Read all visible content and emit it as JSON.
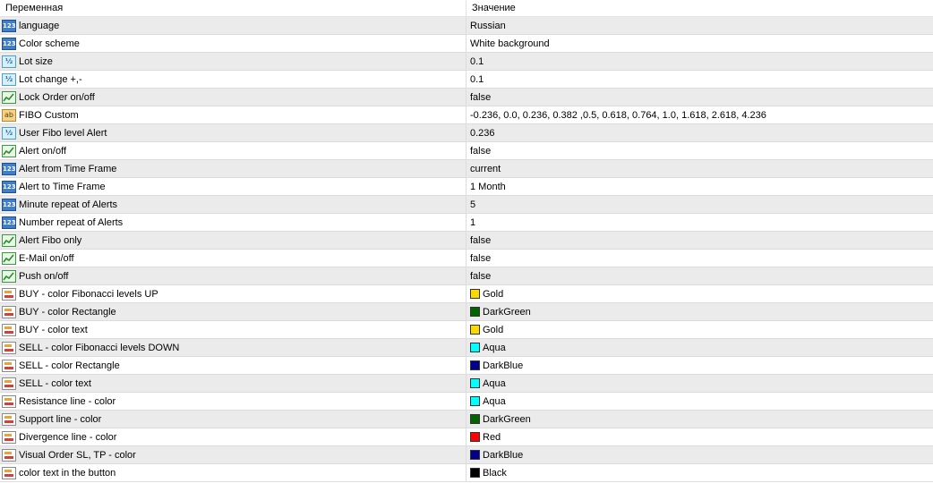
{
  "header": {
    "name_col": "Переменная",
    "value_col": "Значение"
  },
  "rows": [
    {
      "type": "int",
      "icon": "int-123-icon",
      "name": "language",
      "value": "Russian"
    },
    {
      "type": "int",
      "icon": "int-123-icon",
      "name": "Color scheme",
      "value": "White background"
    },
    {
      "type": "double",
      "icon": "double-half-icon",
      "name": "Lot size",
      "value": "0.1"
    },
    {
      "type": "double",
      "icon": "double-half-icon",
      "name": "Lot change +,-",
      "value": "0.1"
    },
    {
      "type": "bool",
      "icon": "bool-chart-icon",
      "name": "Lock Order on/off",
      "value": "false"
    },
    {
      "type": "string",
      "icon": "string-ab-icon",
      "name": "FIBO Custom",
      "value": "-0.236, 0.0, 0.236, 0.382 ,0.5, 0.618, 0.764, 1.0, 1.618, 2.618, 4.236"
    },
    {
      "type": "double",
      "icon": "double-half-icon",
      "name": "User Fibo level Alert",
      "value": "0.236"
    },
    {
      "type": "bool",
      "icon": "bool-chart-icon",
      "name": "Alert on/off",
      "value": "false"
    },
    {
      "type": "int",
      "icon": "int-123-icon",
      "name": "Alert from Time Frame",
      "value": "current"
    },
    {
      "type": "int",
      "icon": "int-123-icon",
      "name": "Alert to Time Frame",
      "value": "1 Month"
    },
    {
      "type": "int",
      "icon": "int-123-icon",
      "name": "Minute repeat of Alerts",
      "value": "5"
    },
    {
      "type": "int",
      "icon": "int-123-icon",
      "name": "Number repeat of Alerts",
      "value": "1"
    },
    {
      "type": "bool",
      "icon": "bool-chart-icon",
      "name": "Alert Fibo only",
      "value": "false"
    },
    {
      "type": "bool",
      "icon": "bool-chart-icon",
      "name": "E-Mail on/off",
      "value": "false"
    },
    {
      "type": "bool",
      "icon": "bool-chart-icon",
      "name": "Push on/off",
      "value": "false"
    },
    {
      "type": "color",
      "icon": "color-palette-icon",
      "name": "BUY -  color Fibonacci levels UP",
      "value": "Gold",
      "color": "#FFD700"
    },
    {
      "type": "color",
      "icon": "color-palette-icon",
      "name": "BUY -  color Rectangle",
      "value": "DarkGreen",
      "color": "#006400"
    },
    {
      "type": "color",
      "icon": "color-palette-icon",
      "name": "BUY -  color text",
      "value": "Gold",
      "color": "#FFD700"
    },
    {
      "type": "color",
      "icon": "color-palette-icon",
      "name": "SELL - color Fibonacci levels DOWN",
      "value": "Aqua",
      "color": "#00FFFF"
    },
    {
      "type": "color",
      "icon": "color-palette-icon",
      "name": "SELL - color Rectangle",
      "value": "DarkBlue",
      "color": "#00008B"
    },
    {
      "type": "color",
      "icon": "color-palette-icon",
      "name": "SELL - color text",
      "value": "Aqua",
      "color": "#00FFFF"
    },
    {
      "type": "color",
      "icon": "color-palette-icon",
      "name": "Resistance line - color",
      "value": "Aqua",
      "color": "#00FFFF"
    },
    {
      "type": "color",
      "icon": "color-palette-icon",
      "name": "Support line - color",
      "value": "DarkGreen",
      "color": "#006400"
    },
    {
      "type": "color",
      "icon": "color-palette-icon",
      "name": "Divergence line - color",
      "value": "Red",
      "color": "#FF0000"
    },
    {
      "type": "color",
      "icon": "color-palette-icon",
      "name": "Visual Order SL, TP - color",
      "value": "DarkBlue",
      "color": "#00008B"
    },
    {
      "type": "color",
      "icon": "color-palette-icon",
      "name": "color text in the button",
      "value": "Black",
      "color": "#000000"
    }
  ],
  "icon_glyphs": {
    "int": "123",
    "double": "½",
    "string": "ab"
  }
}
